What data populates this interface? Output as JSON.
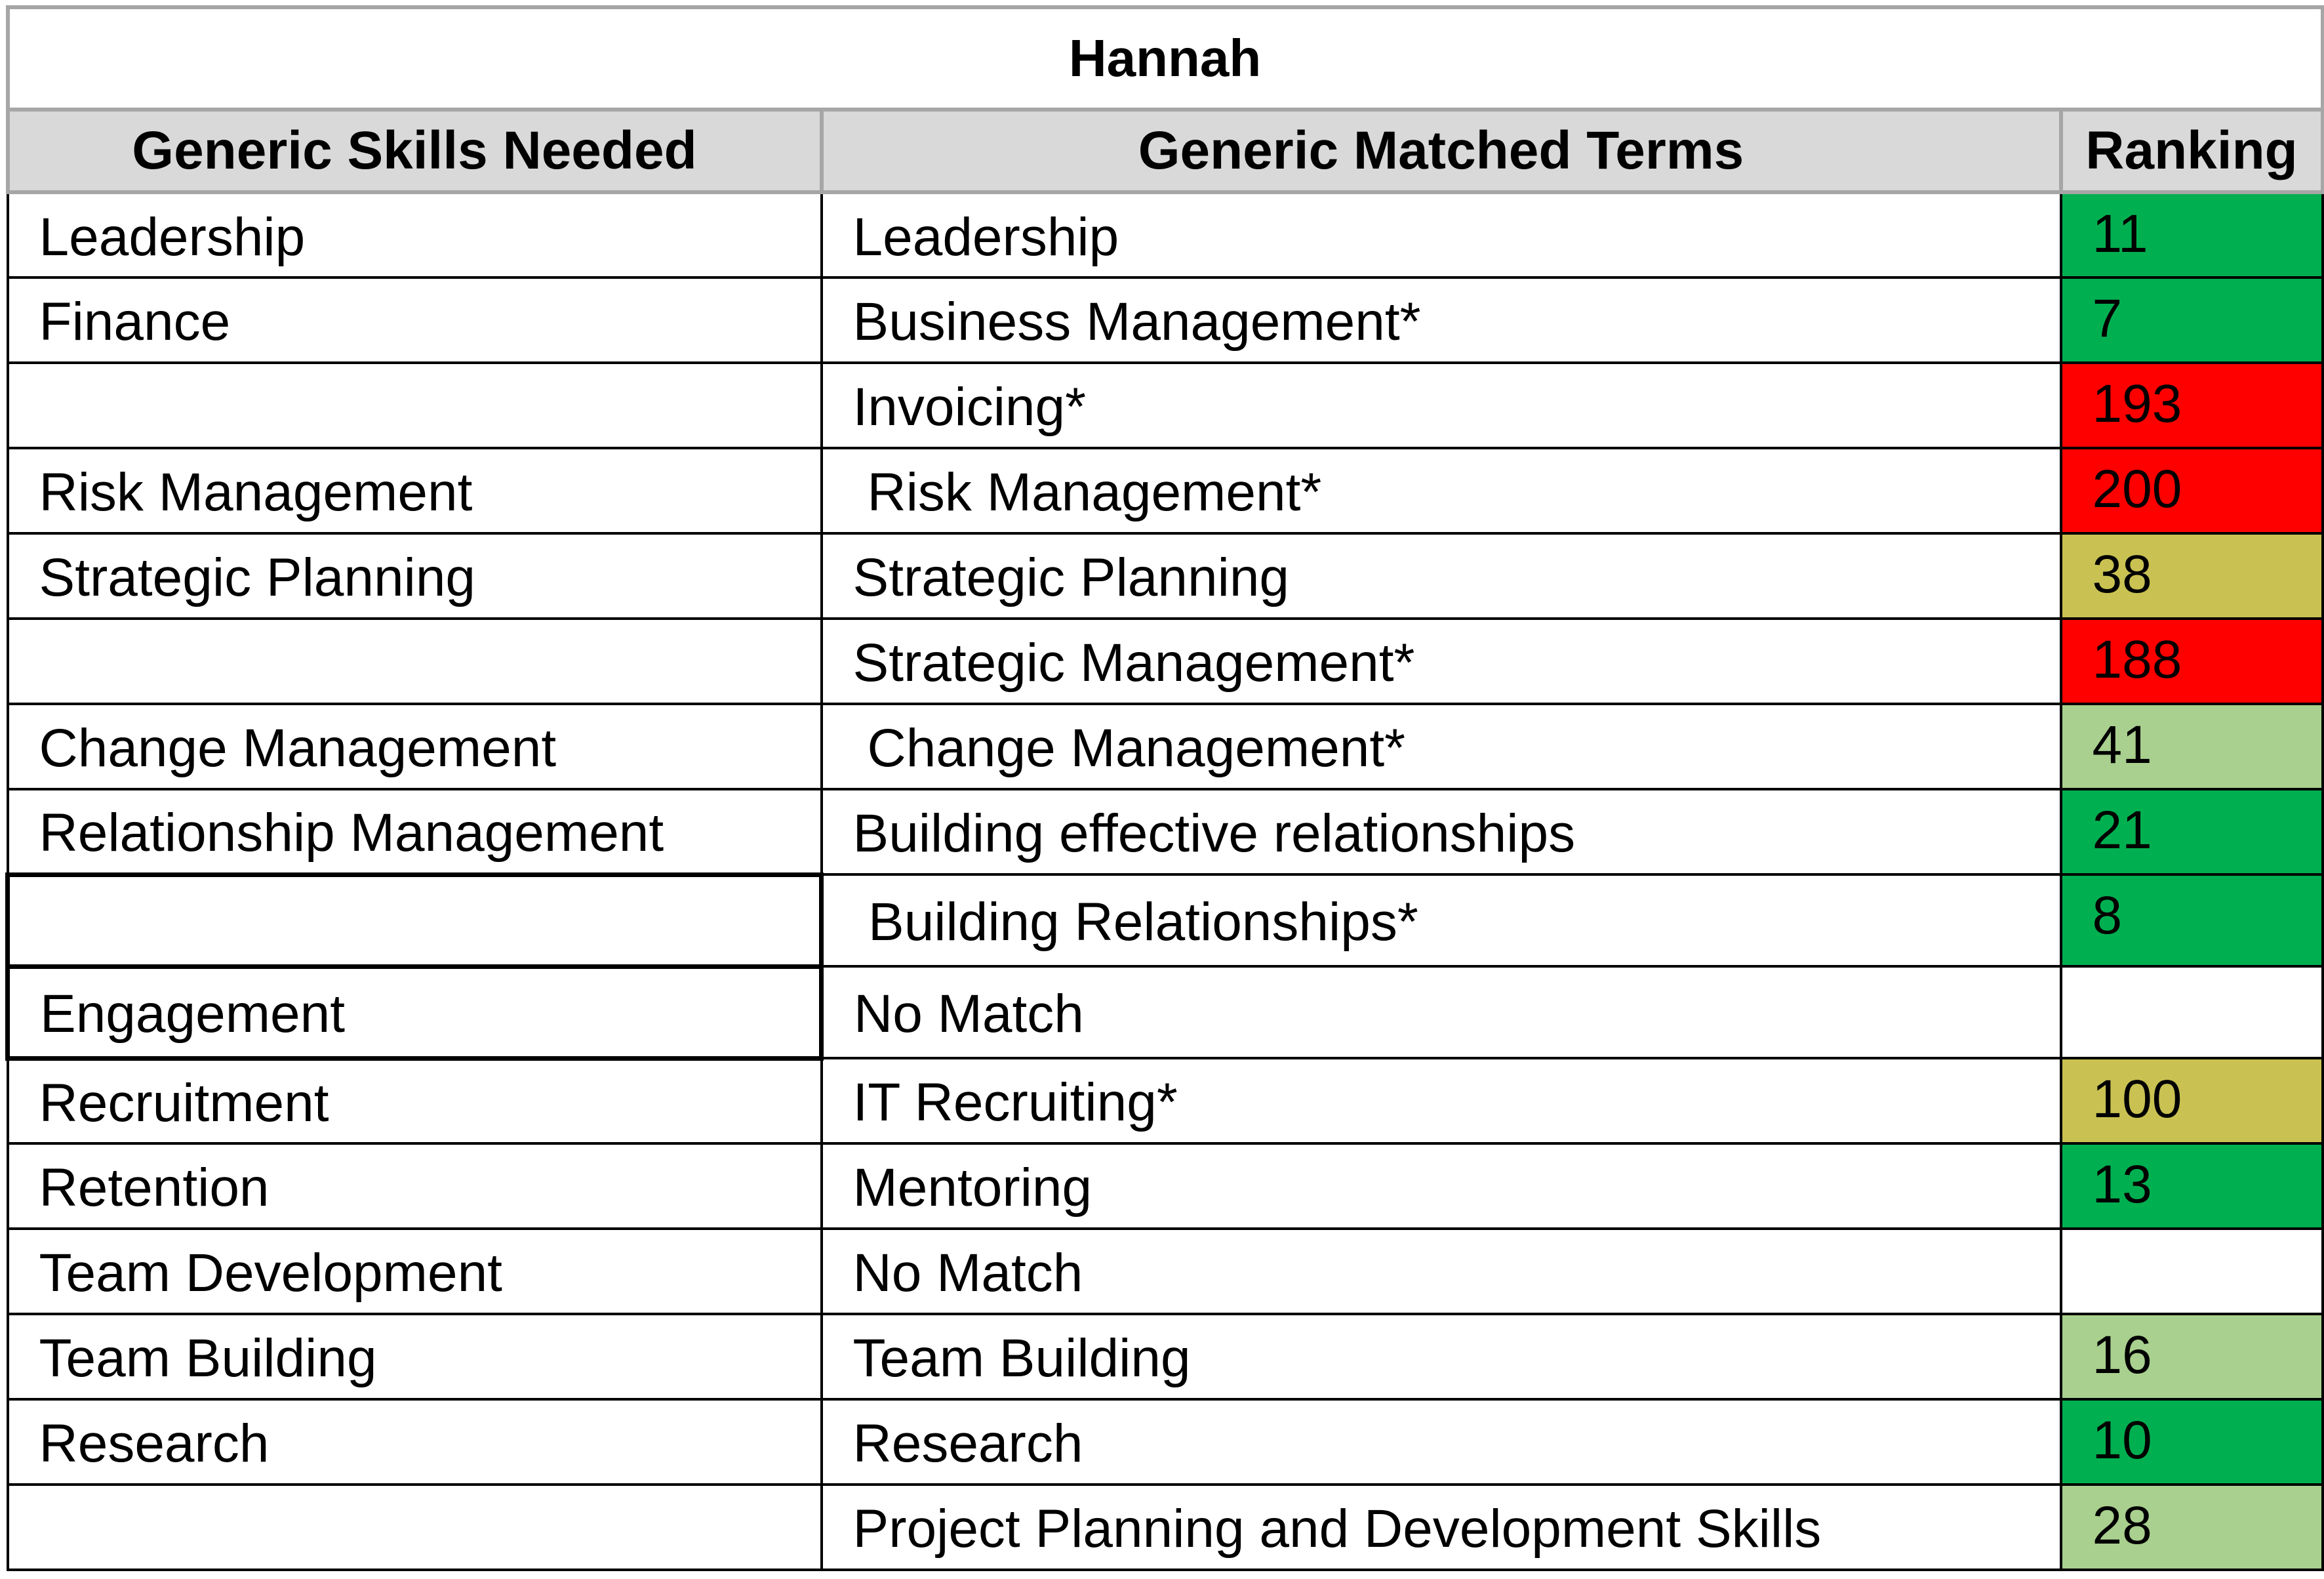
{
  "title": "Hannah",
  "headers": {
    "skills": "Generic Skills Needed",
    "terms": "Generic Matched Terms",
    "ranking": "Ranking"
  },
  "rank_colors": {
    "dark_green": "#00b050",
    "light_green": "#a9d08e",
    "olive": "#c9c252",
    "red": "#ff0000",
    "none": "#ffffff"
  },
  "rows": [
    {
      "skill": "Leadership",
      "term": "Leadership",
      "ranking": "11",
      "color": "#00b050"
    },
    {
      "skill": "Finance",
      "term": "Business Management*",
      "ranking": "7",
      "color": "#00b050"
    },
    {
      "skill": "",
      "term": "Invoicing*",
      "ranking": "193",
      "color": "#ff0000"
    },
    {
      "skill": "Risk Management",
      "term": " Risk Management*",
      "ranking": "200",
      "color": "#ff0000"
    },
    {
      "skill": "Strategic Planning",
      "term": "Strategic Planning",
      "ranking": "38",
      "color": "#c9c252"
    },
    {
      "skill": "",
      "term": "Strategic Management*",
      "ranking": "188",
      "color": "#ff0000"
    },
    {
      "skill": "Change Management",
      "term": " Change Management*",
      "ranking": "41",
      "color": "#a9d08e"
    },
    {
      "skill": "Relationship Management",
      "term": "Building effective relationships",
      "ranking": "21",
      "color": "#00b050"
    },
    {
      "skill": "",
      "term": " Building Relationships*",
      "ranking": "8",
      "color": "#00b050"
    },
    {
      "skill": "Engagement",
      "term": "No Match",
      "ranking": "",
      "color": "#ffffff"
    },
    {
      "skill": "Recruitment",
      "term": "IT Recruiting*",
      "ranking": "100",
      "color": "#c9c252"
    },
    {
      "skill": "Retention",
      "term": "Mentoring",
      "ranking": "13",
      "color": "#00b050"
    },
    {
      "skill": "Team Development",
      "term": "No Match",
      "ranking": "",
      "color": "#ffffff"
    },
    {
      "skill": "Team Building",
      "term": "Team Building",
      "ranking": "16",
      "color": "#a9d08e"
    },
    {
      "skill": "Research",
      "term": "Research",
      "ranking": "10",
      "color": "#00b050"
    },
    {
      "skill": "",
      "term": "Project Planning and Development Skills",
      "ranking": "28",
      "color": "#a9d08e"
    }
  ]
}
